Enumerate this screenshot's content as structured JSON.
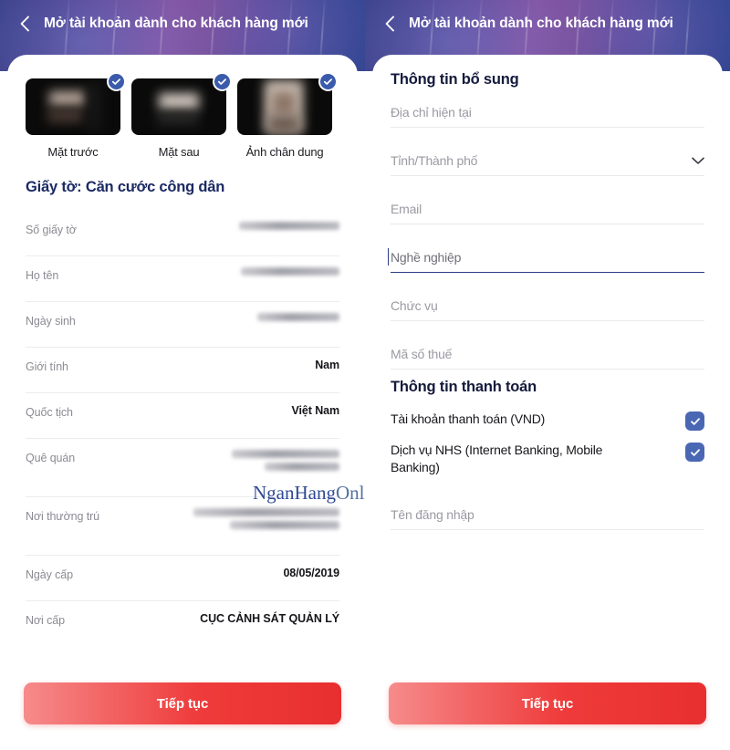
{
  "header": {
    "back_icon": "chevron-left-icon",
    "title": "Mở tài khoản dành cho khách hàng mới"
  },
  "watermark": {
    "part1": "NganHang",
    "part2": "Online.net"
  },
  "left_screen": {
    "thumbnails": [
      {
        "label": "Mặt trước",
        "badge_icon": "check-circle-icon",
        "checked": true
      },
      {
        "label": "Mặt sau",
        "badge_icon": "check-circle-icon",
        "checked": true
      },
      {
        "label": "Ảnh chân dung",
        "badge_icon": "check-circle-icon",
        "checked": true
      }
    ],
    "doc_title": "Giấy tờ: Căn cước công dân",
    "info_rows": [
      {
        "label": "Số giấy tờ",
        "value": "",
        "redacted": true,
        "bars": [
          "w1"
        ]
      },
      {
        "label": "Họ tên",
        "value": "",
        "redacted": true,
        "bars": [
          "w2"
        ]
      },
      {
        "label": "Ngày sinh",
        "value": "",
        "redacted": true,
        "bars": [
          "w3"
        ]
      },
      {
        "label": "Giới tính",
        "value": "Nam",
        "redacted": false,
        "bars": []
      },
      {
        "label": "Quốc tịch",
        "value": "Việt Nam",
        "redacted": false,
        "bars": []
      },
      {
        "label": "Quê quán",
        "value": "",
        "redacted": true,
        "bars": [
          "w5",
          "w4"
        ]
      },
      {
        "label": "Nơi thường trú",
        "value": "",
        "redacted": true,
        "bars": [
          "w6",
          "w7"
        ]
      },
      {
        "label": "Ngày cấp",
        "value": "08/05/2019",
        "redacted": false,
        "bars": []
      },
      {
        "label": "Nơi cấp",
        "value": "CỤC CẢNH SÁT QUẢN LÝ",
        "redacted": false,
        "bars": []
      }
    ],
    "cta_label": "Tiếp tục"
  },
  "right_screen": {
    "section_additional_title": "Thông tin bổ sung",
    "fields": [
      {
        "placeholder": "Địa chỉ hiện tại",
        "value": "",
        "type": "text",
        "focused": false,
        "has_chevron": false
      },
      {
        "placeholder": "Tỉnh/Thành phố",
        "value": "",
        "type": "select",
        "focused": false,
        "has_chevron": true,
        "chevron_icon": "chevron-down-icon"
      },
      {
        "placeholder": "Email",
        "value": "",
        "type": "text",
        "focused": false,
        "has_chevron": false
      },
      {
        "placeholder": "Nghề nghiệp",
        "value": "",
        "type": "text",
        "focused": true,
        "has_chevron": false
      },
      {
        "placeholder": "Chức vụ",
        "value": "",
        "type": "text",
        "focused": false,
        "has_chevron": false
      },
      {
        "placeholder": "Mã số thuế",
        "value": "",
        "type": "text",
        "focused": false,
        "has_chevron": false
      }
    ],
    "section_payment_title": "Thông tin thanh toán",
    "checkboxes": [
      {
        "label": "Tài khoản thanh toán (VND)",
        "checked": true,
        "icon": "check-icon"
      },
      {
        "label": "Dịch vụ NHS (Internet Banking, Mobile Banking)",
        "checked": true,
        "icon": "check-icon"
      }
    ],
    "username_field": {
      "placeholder": "Tên đăng nhập",
      "value": ""
    },
    "cta_label": "Tiếp tục"
  },
  "colors": {
    "header_blue": "#2f4490",
    "header_purple": "#8455a4",
    "title_navy": "#1b2a63",
    "accent_blue": "#3b5bab",
    "checkbox_blue": "#4a67b4",
    "cta_red": "#ef3b3b",
    "label_gray": "#8b8b93"
  }
}
